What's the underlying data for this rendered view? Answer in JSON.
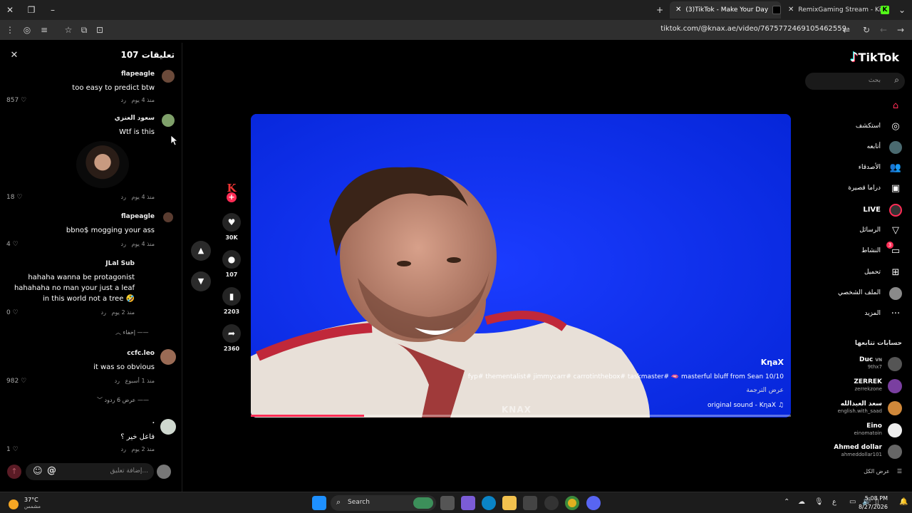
{
  "browser": {
    "tabs": [
      {
        "title": "(3)TikTok - Make Your Day",
        "active": true
      },
      {
        "title": "RemixGaming Stream - Kick Da",
        "active": false
      }
    ],
    "url": "tiktok.com/@knax.ae/video/7675772469105462559"
  },
  "comments": {
    "title": "تعليقات 107",
    "items": [
      {
        "user": "flapeagle",
        "text": "too easy to predict btw",
        "time": "منذ 4 يوم",
        "reply": "رد",
        "likes": "857"
      },
      {
        "user": "سعود العنزي",
        "text": "Wtf is this",
        "time": "منذ 4 يوم",
        "reply": "رد",
        "likes": "18"
      },
      {
        "user": "flapeagle",
        "text": "bbno$ mogging your ass",
        "time": "منذ 4 يوم",
        "reply": "رد",
        "likes": "4"
      },
      {
        "user": "JLal Sub",
        "text": "hahaha wanna be protagonist hahahaha no man your just a leaf in this world not a tree 🤣",
        "time": "منذ 2 يوم",
        "reply": "رد",
        "likes": "0"
      },
      {
        "user": "ccfc.leo",
        "text": "it was so obvious",
        "time": "منذ 1 أسبوع",
        "reply": "رد",
        "likes": "982"
      },
      {
        "user": ".",
        "text": "فاعل خير ؟",
        "time": "منذ 2 يوم",
        "reply": "رد",
        "likes": "1"
      }
    ],
    "hide_label": "إخفاء",
    "view_replies_label": "عرض 6 ردود",
    "composer_placeholder": "إضافة تعليق...",
    "composer_at": "@"
  },
  "actions": {
    "creator_initials": "K",
    "likes": "30K",
    "comments": "107",
    "saves": "2203",
    "shares": "2360"
  },
  "video": {
    "handle": "KηaX",
    "caption": "fyp# thementalist# jimmycarr# carrotinthebox# taskmaster# 🫦 masterful bluff from Sean 10/10",
    "translate": "عرض الترجمة",
    "sound": "original sound - KηaX",
    "watermark": "KNAX",
    "progress": 0.21
  },
  "sidebar": {
    "logo": "TikTok",
    "search_placeholder": "بحث",
    "nav": [
      {
        "label": "",
        "icon": "home-icon"
      },
      {
        "label": "استكشف",
        "icon": "compass-icon"
      },
      {
        "label": "أتابعه",
        "icon": "following-icon"
      },
      {
        "label": "الأصدقاء",
        "icon": "friends-icon"
      },
      {
        "label": "دراما قصيرة",
        "icon": "drama-icon"
      },
      {
        "label": "LIVE",
        "icon": "live-icon"
      },
      {
        "label": "الرسائل",
        "icon": "messages-icon"
      },
      {
        "label": "النشاط",
        "icon": "activity-icon",
        "badge": "3"
      },
      {
        "label": "تحميل",
        "icon": "upload-icon"
      },
      {
        "label": "الملف الشخصي",
        "icon": "profile-icon"
      },
      {
        "label": "المزيد",
        "icon": "more-icon"
      }
    ],
    "following_header": "حسابات تتابعها",
    "accounts": [
      {
        "name": "Duc",
        "handle": "9thx7",
        "tag": "VN"
      },
      {
        "name": "ZERREK",
        "handle": "zerrekzone",
        "tag": ""
      },
      {
        "name": "سعد العبدالله",
        "handle": "english.with_saad",
        "tag": ""
      },
      {
        "name": "Eino",
        "handle": "einomatoin",
        "tag": ""
      },
      {
        "name": "Ahmed dollar",
        "handle": "ahmeddollar101",
        "tag": ""
      }
    ],
    "see_all": "عرض الكل"
  },
  "taskbar": {
    "temp": "37°C",
    "condition": "مشمس",
    "search": "Search",
    "lang": "ع",
    "time": "5:08 PM",
    "date": "8/27/2026"
  }
}
